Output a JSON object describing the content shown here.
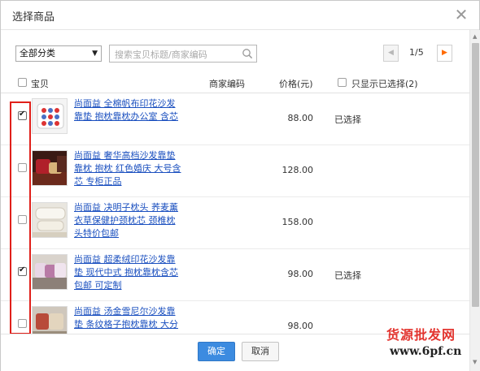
{
  "dialog": {
    "title": "选择商品",
    "close_glyph": "✕"
  },
  "toolbar": {
    "category_select": "全部分类",
    "search_placeholder": "搜索宝贝标题/商家编码",
    "pager_text": "1/5"
  },
  "table": {
    "headers": {
      "item": "宝贝",
      "merchant_code": "商家编码",
      "price": "价格(元)",
      "show_selected_only": "只显示已选择(2)"
    },
    "rows": [
      {
        "title": "尚面益 全棉帆布印花沙发靠垫 抱枕靠枕办公室 含芯",
        "price": "88.00",
        "status": "已选择",
        "checked": true
      },
      {
        "title": "尚面益 奢华高档沙发靠垫靠枕 抱枕 红色婚庆 大号含芯 专柜正品",
        "price": "128.00",
        "status": "",
        "checked": false
      },
      {
        "title": "尚面益 决明子枕头 荞麦薰衣草保健护颈枕芯 颈椎枕头特价包邮",
        "price": "158.00",
        "status": "",
        "checked": false
      },
      {
        "title": "尚面益 超柔绒印花沙发靠垫 现代中式 抱枕靠枕含芯包邮 可定制",
        "price": "98.00",
        "status": "已选择",
        "checked": true
      },
      {
        "title": "尚面益 汤金雪尼尔沙发靠垫 条纹格子抱枕靠枕 大分",
        "price": "98.00",
        "status": "",
        "checked": false
      }
    ]
  },
  "footer": {
    "ok_label": "确定",
    "cancel_label": "取消"
  },
  "watermark": {
    "line1": "货源批发网",
    "line2": "www.6pf.cn"
  },
  "colors": {
    "accent": "#3c8be0",
    "link": "#1a4fbf",
    "highlight_box": "#e0201a",
    "pager_active": "#ff6a00"
  }
}
